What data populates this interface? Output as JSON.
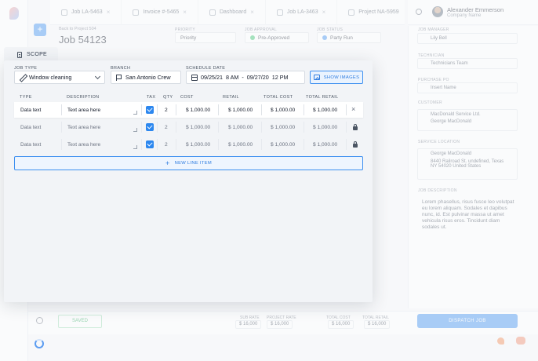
{
  "background": {
    "tabs": [
      {
        "label": "Job LA-5463"
      },
      {
        "label": "Invoice #-5465"
      },
      {
        "label": "Dashboard"
      },
      {
        "label": "Job LA-3463"
      },
      {
        "label": "Project NA-5959"
      }
    ],
    "user": {
      "name": "Alexander Emmerson",
      "company": "Company Name"
    },
    "breadcrumb": "Back to Project 504",
    "job_title": "Job 54123",
    "header_fields": [
      {
        "label": "PRIORITY",
        "value": "Priority"
      },
      {
        "label": "JOB APPROVAL",
        "value": "Pre-Approved"
      },
      {
        "label": "JOB STATUS",
        "value": "Party Run"
      }
    ],
    "right_panel": {
      "assignee_label": "JOB MANAGER",
      "assignee": "Lily Bell",
      "technician_label": "TECHNICIAN",
      "technician": "Technicians Team",
      "po_label": "PURCHASE PO",
      "po_placeholder": "Insert Name",
      "customer_label": "CUSTOMER",
      "customer_1": "MacDonald Service Ltd.",
      "customer_2": "George MacDonald",
      "service_label": "SERVICE LOCATION",
      "service_1": "George MacDonald",
      "service_2": "8440 Railroad St. undefined, Texas",
      "service_3": "NY 54020 United States",
      "description_label": "JOB DESCRIPTION",
      "description": "Lorem phasellus, risus fusce leo volutpat eu lorem aliquam. Sodales et dapibus nunc, id. Est pulvinar massa ut amet vehicula risus eros. Tincidunt diam sodales ut."
    },
    "bottom": {
      "saved_label": "SAVED",
      "summary": [
        {
          "label": "SUB RATE",
          "value": "$ 16,000"
        },
        {
          "label": "PROJECT RATE",
          "value": "$ 16,000"
        },
        {
          "label": "TOTAL COST",
          "value": "$ 16,000"
        },
        {
          "label": "TOTAL RETAIL",
          "value": "$ 16,000"
        }
      ],
      "dispatch_label": "DISPATCH JOB"
    }
  },
  "modal": {
    "tab_label": "SCOPE",
    "job_type": {
      "label": "JOB TYPE",
      "value": "Window cleaning"
    },
    "branch": {
      "label": "BRANCH",
      "value": "San Antonio Crew"
    },
    "schedule": {
      "label": "SCHEDULE DATE",
      "start": "09/25/21",
      "start_time": "8 AM",
      "separator": "-",
      "end": "09/27/20",
      "end_time": "12 PM"
    },
    "show_images_label": "SHOW IMAGES",
    "columns": [
      "TYPE",
      "DESCRIPTION",
      "TAX",
      "QTY",
      "COST",
      "RETAIL",
      "TOTAL COST",
      "TOTAL RETAIL"
    ],
    "rows": [
      {
        "type": "Data text",
        "description": "Text area here",
        "qty": "2",
        "cost": "$ 1,000.00",
        "retail": "$ 1,000.00",
        "total_cost": "$ 1,000.00",
        "total_retail": "$ 1,000.00"
      },
      {
        "type": "Data text",
        "description": "Text area here",
        "qty": "2",
        "cost": "$ 1,000.00",
        "retail": "$ 1,000.00",
        "total_cost": "$ 1,000.00",
        "total_retail": "$ 1,000.00"
      },
      {
        "type": "Data text",
        "description": "Text area here",
        "qty": "2",
        "cost": "$ 1,000.00",
        "retail": "$ 1,000.00",
        "total_cost": "$ 1,000.00",
        "total_retail": "$ 1,000.00"
      }
    ],
    "new_line_label": "NEW LINE ITEM",
    "colors": {
      "accent": "#3c8ff0",
      "checkbox": "#2c87ef"
    }
  }
}
